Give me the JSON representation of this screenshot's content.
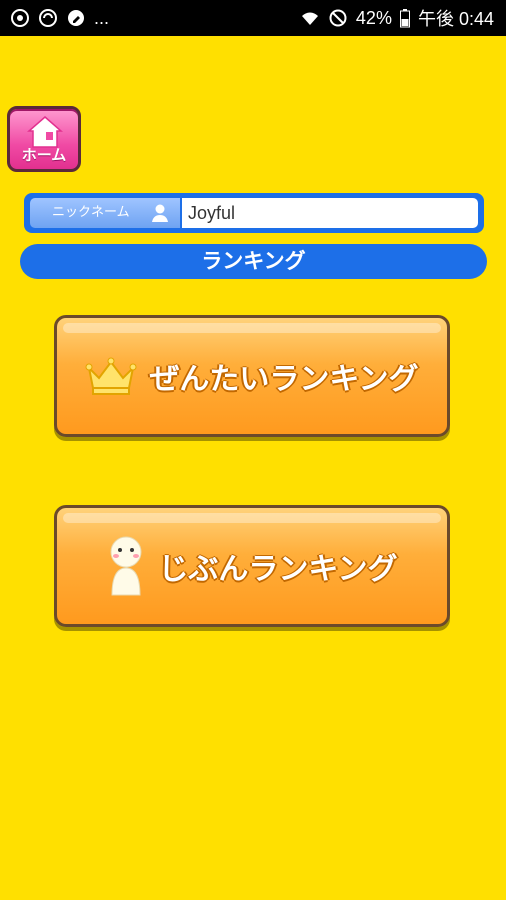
{
  "status_bar": {
    "left_text": "...",
    "battery": "42%",
    "time": "午後 0:44"
  },
  "home": {
    "label": "ホーム"
  },
  "nickname": {
    "label": "ニックネーム",
    "value": "Joyful"
  },
  "section": {
    "title": "ランキング"
  },
  "buttons": {
    "overall": {
      "label": "ぜんたいランキング",
      "icon": "crown-icon"
    },
    "personal": {
      "label": "じぶんランキング",
      "icon": "character-icon"
    }
  },
  "colors": {
    "background": "#FFE000",
    "accent_blue": "#1D6FE8",
    "button_orange": "#FFAE3A",
    "home_pink": "#F04AA4"
  }
}
